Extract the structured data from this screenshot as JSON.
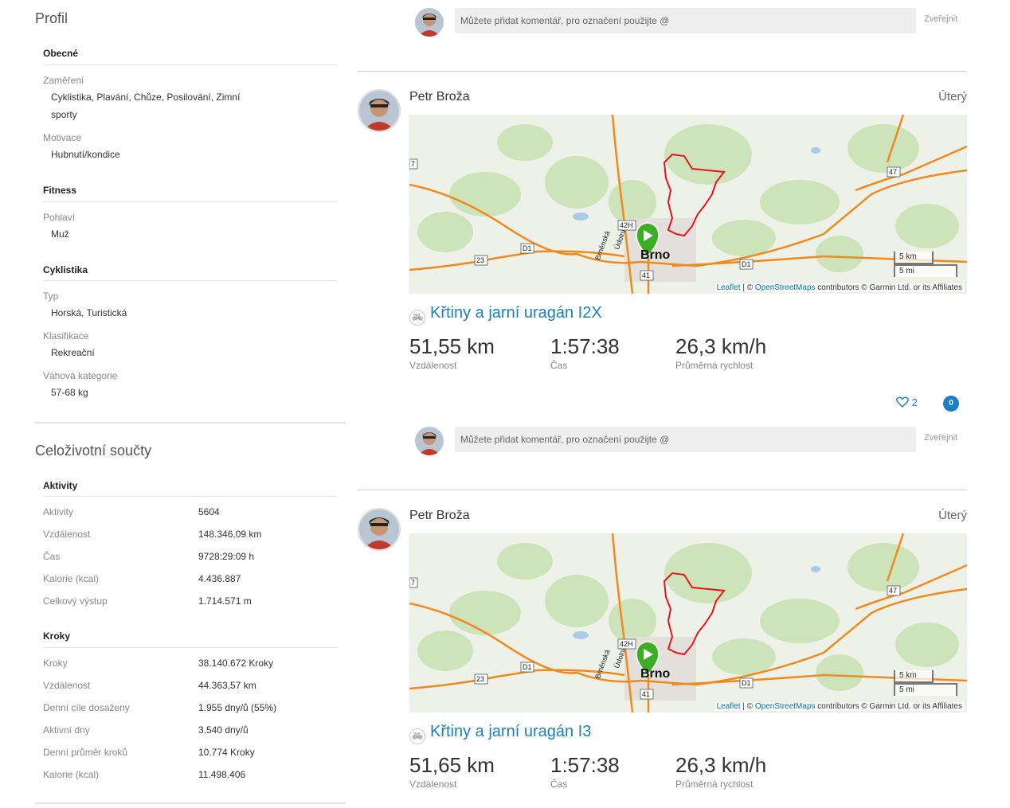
{
  "profile": {
    "title": "Profil",
    "general": {
      "heading": "Obecné",
      "focus_label": "Zaměření",
      "focus_value": "Cyklistika, Plavání, Chůze, Posilování, Zimní sporty",
      "motivation_label": "Motivace",
      "motivation_value": "Hubnutí/kondice"
    },
    "fitness": {
      "heading": "Fitness",
      "gender_label": "Pohlaví",
      "gender_value": "Muž"
    },
    "cycling": {
      "heading": "Cyklistika",
      "type_label": "Typ",
      "type_value": "Horská, Turistická",
      "class_label": "Klasifikace",
      "class_value": "Rekreační",
      "weight_label": "Váhová kategorie",
      "weight_value": "57-68 kg"
    }
  },
  "lifetime": {
    "title": "Celoživotní součty",
    "activities": {
      "heading": "Aktivity",
      "rows": [
        {
          "label": "Aktivity",
          "value": "5604"
        },
        {
          "label": "Vzdálenost",
          "value": "148.346,09 km"
        },
        {
          "label": "Čas",
          "value": "9728:29:09 h"
        },
        {
          "label": "Kalorie (kcal)",
          "value": "4.436.887"
        },
        {
          "label": "Celkový výstup",
          "value": "1.714.571 m"
        }
      ]
    },
    "steps": {
      "heading": "Kroky",
      "rows": [
        {
          "label": "Kroky",
          "value": "38.140.672 Kroky"
        },
        {
          "label": "Vzdálenost",
          "value": "44.363,57 km"
        },
        {
          "label": "Denní cíle dosaženy",
          "value": "1.955 dny/ů (55%)"
        },
        {
          "label": "Aktivní dny",
          "value": "3.540 dny/ů"
        },
        {
          "label": "Denní průměr kroků",
          "value": "10.774 Kroky"
        },
        {
          "label": "Kalorie (kcal)",
          "value": "11.498.406"
        }
      ]
    }
  },
  "comment": {
    "placeholder": "Můžete přidat komentář, pro označení použijte @",
    "publish": "Zveřejnit"
  },
  "map": {
    "city": "Brno",
    "road_labels": [
      "42H",
      "D1",
      "D1",
      "23",
      "41",
      "47",
      "7",
      "Brněnská",
      "Údolní"
    ],
    "scale_km": "5 km",
    "scale_mi": "5 mi",
    "attribution_leaflet": "Leaflet",
    "attribution_sep": " | © ",
    "attribution_osm": "OpenStreetMaps",
    "attribution_rest": " contributors © Garmin Ltd. or its Affiliates",
    "route_color": "#e8141b",
    "road_color": "#f08a1c",
    "marker_color": "#3cae23"
  },
  "feed": [
    {
      "user": "Petr Broža",
      "day": "Úterý",
      "activity_title": "Křtiny a jarní uragán I2X",
      "distance": "51,55 km",
      "distance_label": "Vzdálenost",
      "time": "1:57:38",
      "time_label": "Čas",
      "speed": "26,3 km/h",
      "speed_label": "Průměrná rychlost",
      "likes": "2",
      "comments": "0"
    },
    {
      "user": "Petr Broža",
      "day": "Úterý",
      "activity_title": "Křtiny a jarní uragán I3",
      "distance": "51,65 km",
      "distance_label": "Vzdálenost",
      "time": "1:57:38",
      "time_label": "Čas",
      "speed": "26,3 km/h",
      "speed_label": "Průměrná rychlost"
    }
  ]
}
